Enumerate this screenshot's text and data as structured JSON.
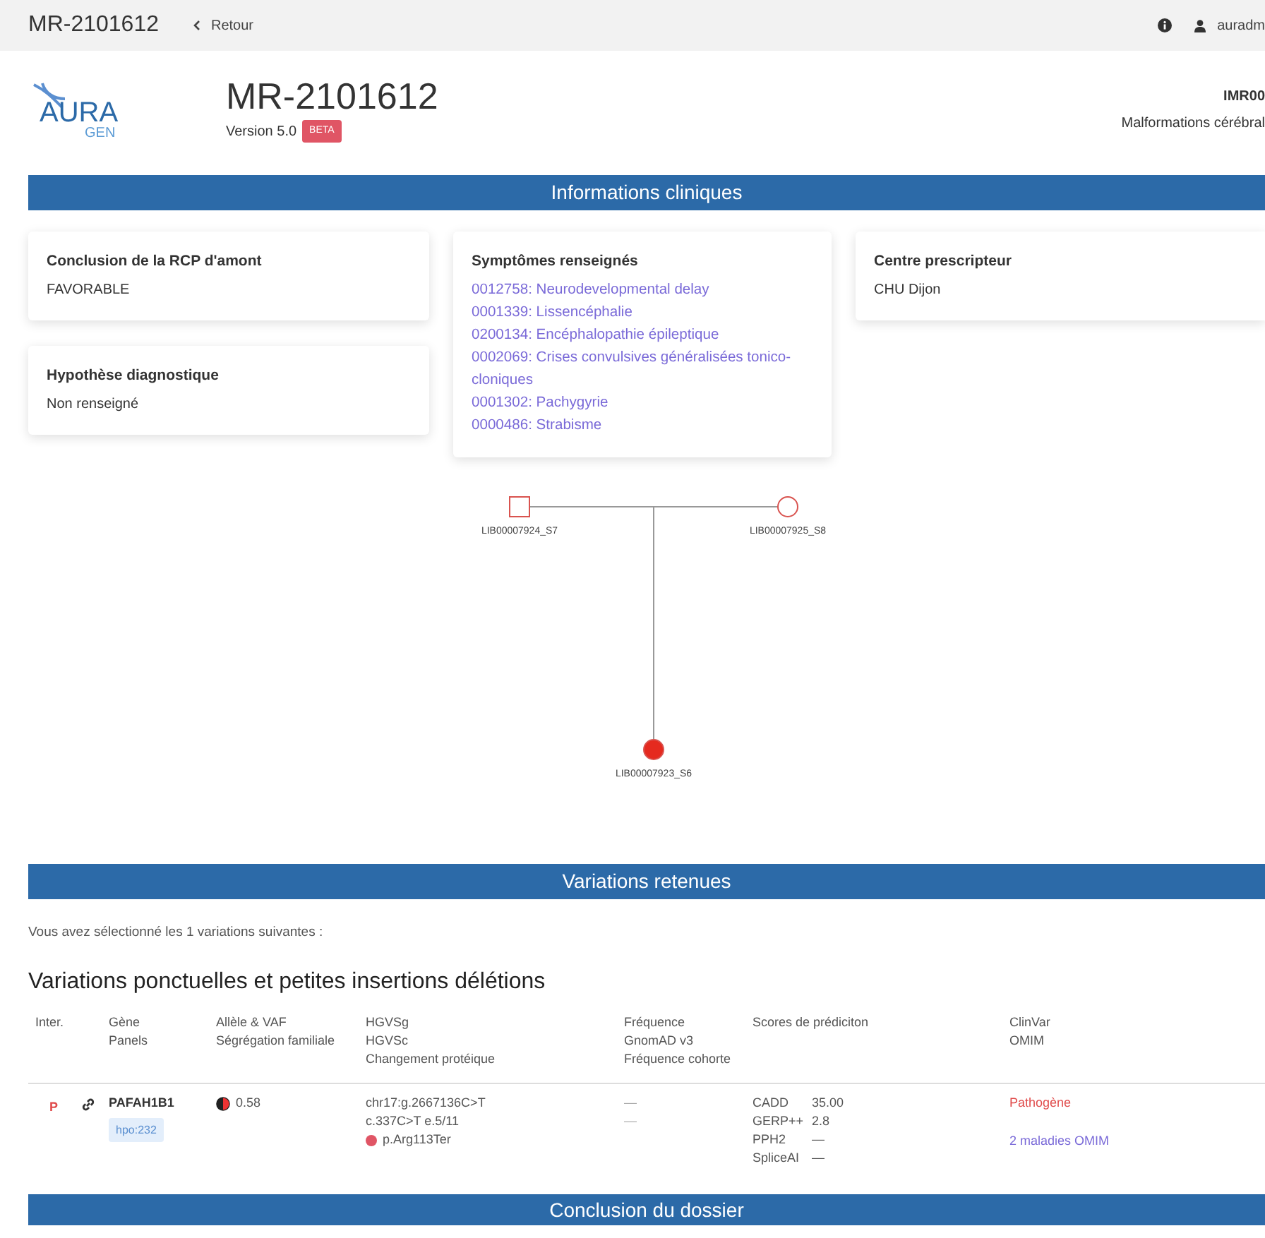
{
  "navbar": {
    "title": "MR-2101612",
    "back": "Retour",
    "user": "auradm"
  },
  "header": {
    "logo_top": "AURA",
    "logo_bottom": "GEN",
    "title": "MR-2101612",
    "version": "Version 5.0",
    "badge": "BETA",
    "code": "IMR00",
    "subtitle": "Malformations cérébral"
  },
  "clinical": {
    "title": "Informations cliniques",
    "cards": [
      {
        "title": "Conclusion de la RCP d'amont",
        "value": "FAVORABLE"
      },
      {
        "title": "Hypothèse diagnostique",
        "value": "Non renseigné"
      },
      {
        "title": "Centre prescripteur",
        "value": "CHU Dijon"
      }
    ],
    "symptoms": {
      "title": "Symptômes renseignés",
      "items": [
        "0012758: Neurodevelopmental delay",
        "0001339: Lissencéphalie",
        "0200134: Encéphalopathie épileptique",
        "0002069: Crises convulsives généralisées tonico-cloniques",
        "0001302: Pachygyrie",
        "0000486: Strabisme"
      ]
    }
  },
  "pedigree": {
    "parents": [
      {
        "label": "LIB00007924_S7",
        "kind": "male",
        "affected": false
      },
      {
        "label": "LIB00007925_S8",
        "kind": "female",
        "affected": false
      }
    ],
    "child": {
      "label": "LIB00007923_S6",
      "kind": "female",
      "affected": true
    }
  },
  "variations": {
    "title": "Variations retenues",
    "intro": "Vous avez sélectionné les 1 variations suivantes :",
    "heading": "Variations ponctuelles et petites insertions délétions",
    "columns": [
      [
        "Inter."
      ],
      [
        "Gène",
        "Panels"
      ],
      [
        "Allèle & VAF",
        "Ségrégation familiale"
      ],
      [
        "HGVSg",
        "HGVSc",
        "Changement protéique"
      ],
      [
        "Fréquence",
        "GnomAD v3",
        "Fréquence cohorte"
      ],
      [
        "Scores de prédiciton"
      ],
      [
        "ClinVar",
        "OMIM"
      ]
    ],
    "rows": [
      {
        "inter": "P",
        "gene": "PAFAH1B1",
        "panel": "hpo:232",
        "vaf": "0.58",
        "hgvsg": "chr17:g.2667136C>T",
        "hgvsc": "c.337C>T e.5/11",
        "protein": "p.Arg113Ter",
        "gnomad": "—",
        "cohort": "—",
        "scores": [
          {
            "name": "CADD",
            "value": "35.00"
          },
          {
            "name": "GERP++",
            "value": "2.8"
          },
          {
            "name": "PPH2",
            "value": "—"
          },
          {
            "name": "SpliceAI",
            "value": "—"
          }
        ],
        "clinvar": "Pathogène",
        "omim": "2 maladies OMIM"
      }
    ]
  },
  "conclusion": {
    "title": "Conclusion du dossier"
  }
}
